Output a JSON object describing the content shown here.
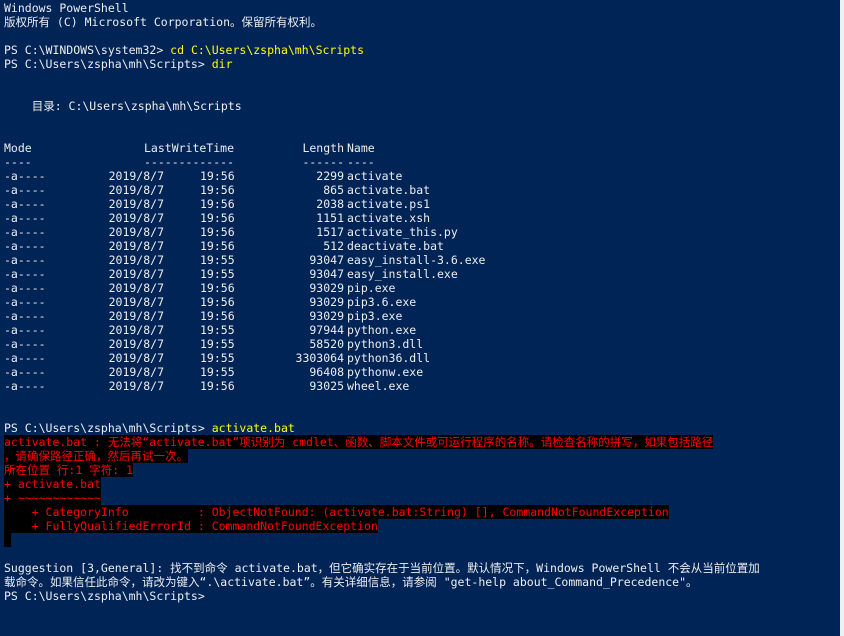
{
  "window": {
    "header_line1": "Windows PowerShell",
    "header_line2": "版权所有 (C) Microsoft Corporation。保留所有权利。"
  },
  "colors": {
    "background": "#012456",
    "text": "#eeedf0",
    "command": "#ffff00",
    "error_text": "#ff0000",
    "error_background": "#000000"
  },
  "session": {
    "cmd1": {
      "prompt": "PS C:\\WINDOWS\\system32> ",
      "command": "cd C:\\Users\\zspha\\mh\\Scripts"
    },
    "cmd2": {
      "prompt": "PS C:\\Users\\zspha\\mh\\Scripts> ",
      "command": "dir"
    },
    "directory_line": "    目录: C:\\Users\\zspha\\mh\\Scripts",
    "listing_headers": {
      "mode": "Mode",
      "lastwritetime": "LastWriteTime",
      "length": "Length",
      "name": "Name"
    },
    "listing_rules": {
      "mode": "----",
      "lastwritetime": "-------------",
      "length": "------",
      "name": "----"
    },
    "files": [
      {
        "mode": "-a----",
        "date": "2019/8/7",
        "time": "19:56",
        "length": "2299",
        "name": "activate"
      },
      {
        "mode": "-a----",
        "date": "2019/8/7",
        "time": "19:56",
        "length": "865",
        "name": "activate.bat"
      },
      {
        "mode": "-a----",
        "date": "2019/8/7",
        "time": "19:56",
        "length": "2038",
        "name": "activate.ps1"
      },
      {
        "mode": "-a----",
        "date": "2019/8/7",
        "time": "19:56",
        "length": "1151",
        "name": "activate.xsh"
      },
      {
        "mode": "-a----",
        "date": "2019/8/7",
        "time": "19:56",
        "length": "1517",
        "name": "activate_this.py"
      },
      {
        "mode": "-a----",
        "date": "2019/8/7",
        "time": "19:56",
        "length": "512",
        "name": "deactivate.bat"
      },
      {
        "mode": "-a----",
        "date": "2019/8/7",
        "time": "19:55",
        "length": "93047",
        "name": "easy_install-3.6.exe"
      },
      {
        "mode": "-a----",
        "date": "2019/8/7",
        "time": "19:55",
        "length": "93047",
        "name": "easy_install.exe"
      },
      {
        "mode": "-a----",
        "date": "2019/8/7",
        "time": "19:56",
        "length": "93029",
        "name": "pip.exe"
      },
      {
        "mode": "-a----",
        "date": "2019/8/7",
        "time": "19:56",
        "length": "93029",
        "name": "pip3.6.exe"
      },
      {
        "mode": "-a----",
        "date": "2019/8/7",
        "time": "19:56",
        "length": "93029",
        "name": "pip3.exe"
      },
      {
        "mode": "-a----",
        "date": "2019/8/7",
        "time": "19:55",
        "length": "97944",
        "name": "python.exe"
      },
      {
        "mode": "-a----",
        "date": "2019/8/7",
        "time": "19:55",
        "length": "58520",
        "name": "python3.dll"
      },
      {
        "mode": "-a----",
        "date": "2019/8/7",
        "time": "19:55",
        "length": "3303064",
        "name": "python36.dll"
      },
      {
        "mode": "-a----",
        "date": "2019/8/7",
        "time": "19:55",
        "length": "96408",
        "name": "pythonw.exe"
      },
      {
        "mode": "-a----",
        "date": "2019/8/7",
        "time": "19:56",
        "length": "93025",
        "name": "wheel.exe"
      }
    ],
    "cmd3": {
      "prompt": "PS C:\\Users\\zspha\\mh\\Scripts> ",
      "command": "activate.bat"
    },
    "error_lines": [
      "activate.bat : 无法将“activate.bat”项识别为 cmdlet、函数、脚本文件或可运行程序的名称。请检查名称的拼写，如果包括路径",
      "，请确保路径正确，然后再试一次。",
      "所在位置 行:1 字符: 1",
      "+ activate.bat",
      "+ ~~~~~~~~~~~~",
      "    + CategoryInfo          : ObjectNotFound: (activate.bat:String) [], CommandNotFoundException",
      "    + FullyQualifiedErrorId : CommandNotFoundException",
      " "
    ],
    "suggestion_lines": [
      "Suggestion [3,General]: 找不到命令 activate.bat，但它确实存在于当前位置。默认情况下，Windows PowerShell 不会从当前位置加",
      "载命令。如果信任此命令，请改为键入“.\\activate.bat”。有关详细信息，请参阅 \"get-help about_Command_Precedence\"。"
    ],
    "final_prompt": "PS C:\\Users\\zspha\\mh\\Scripts> "
  }
}
